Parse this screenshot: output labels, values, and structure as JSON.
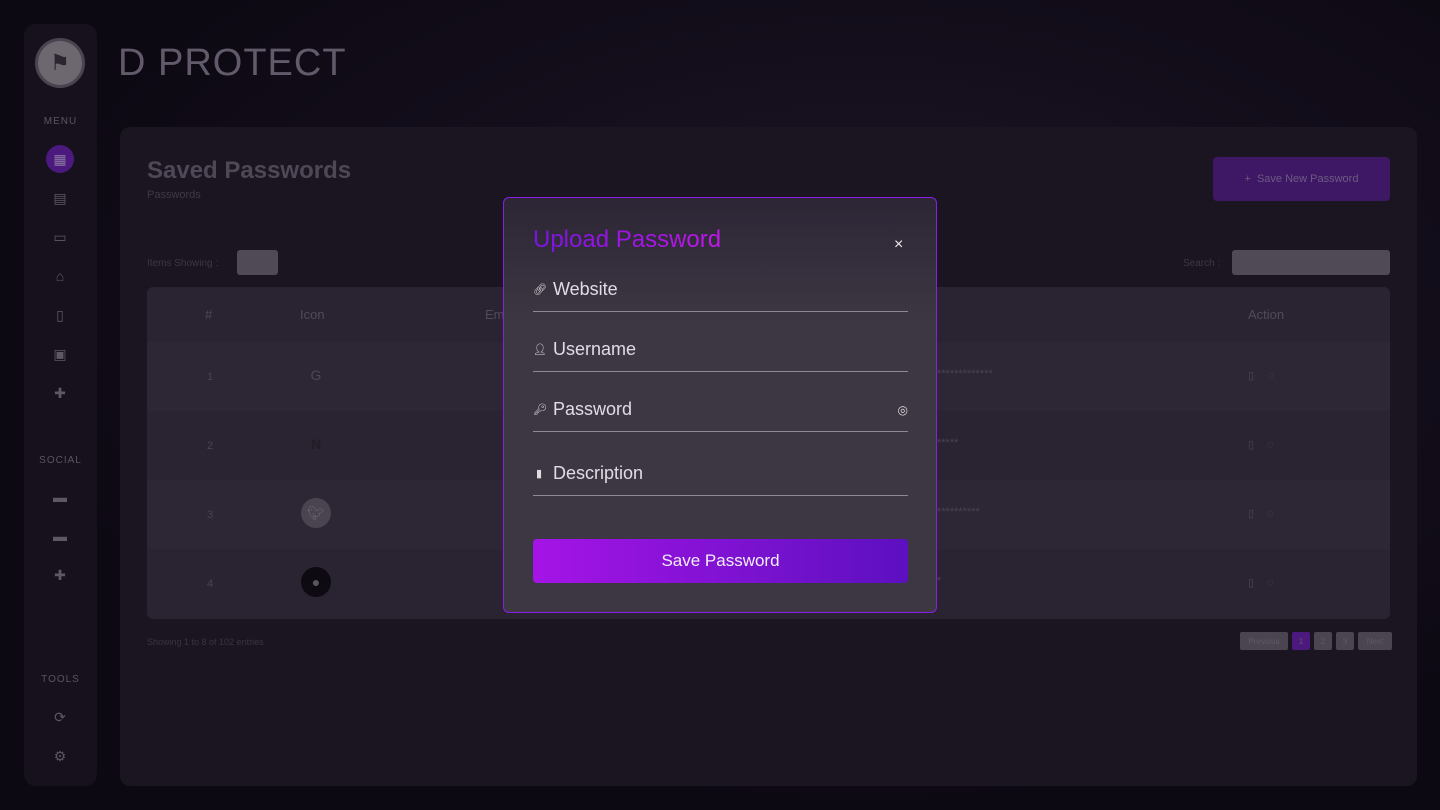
{
  "app": {
    "title": "D PROTECT"
  },
  "sidebar": {
    "menu_label": "MENU",
    "social_label": "SOCIAL",
    "tools_label": "TOOLS",
    "menu_icons": [
      "dashboard-icon",
      "id-card-icon",
      "credit-card-icon",
      "home-icon",
      "document-icon",
      "notes-icon",
      "plus-icon"
    ],
    "social_icons": [
      "folder-icon",
      "folder-icon",
      "plus-icon"
    ],
    "tools_icons": [
      "refresh-icon",
      "settings-icon"
    ]
  },
  "page": {
    "title": "Saved Passwords",
    "subtitle": "Passwords",
    "new_button": "Save New Password",
    "items_showing_label": "Items Showing :",
    "search_label": "Search :"
  },
  "table": {
    "headers": {
      "num": "#",
      "icon": "Icon",
      "email": "Em",
      "action": "Action"
    },
    "rows": [
      {
        "num": "1",
        "icon": "google-icon",
        "password": "*************"
      },
      {
        "num": "2",
        "icon": "netflix-icon",
        "password": "*****"
      },
      {
        "num": "3",
        "icon": "twitter-icon",
        "password": "**********"
      },
      {
        "num": "4",
        "icon": "github-icon",
        "password": "*"
      }
    ],
    "footer": "Showing 1 to 8 of 102 entries",
    "pagination": {
      "prev": "Previous",
      "pages": [
        "1",
        "2",
        "3"
      ],
      "current": "1",
      "next": "Next"
    }
  },
  "modal": {
    "title": "Upload Password",
    "close": "×",
    "fields": {
      "website": "Website",
      "username": "Username",
      "password": "Password",
      "description": "Description"
    },
    "save_button": "Save Password"
  },
  "colors": {
    "accent": "#a514e6",
    "accent_dark": "#5c10c0",
    "border": "#8a1ee0"
  }
}
